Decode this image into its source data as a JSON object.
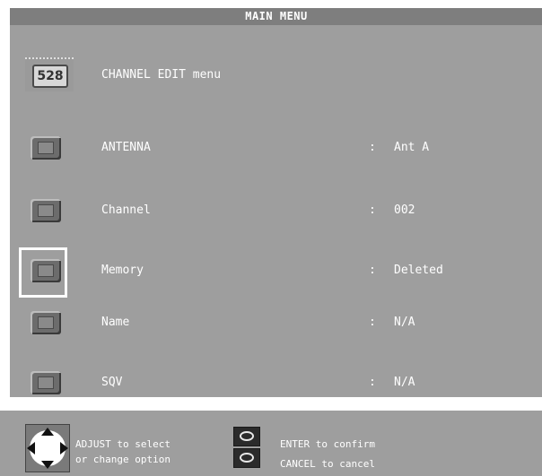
{
  "title": "MAIN MENU",
  "header": {
    "icon_text": "528",
    "label": "CHANNEL EDIT menu"
  },
  "rows": [
    {
      "label": "ANTENNA",
      "colon": ":",
      "value": "Ant A"
    },
    {
      "label": "Channel",
      "colon": ":",
      "value": "002"
    },
    {
      "label": "Memory",
      "colon": ":",
      "value": "Deleted"
    },
    {
      "label": "Name",
      "colon": ":",
      "value": "N/A"
    },
    {
      "label": "SQV",
      "colon": ":",
      "value": "N/A"
    }
  ],
  "help": {
    "adjust_line1": "ADJUST to select",
    "adjust_line2": "or change option",
    "enter": "ENTER to confirm",
    "cancel": "CANCEL to cancel"
  }
}
